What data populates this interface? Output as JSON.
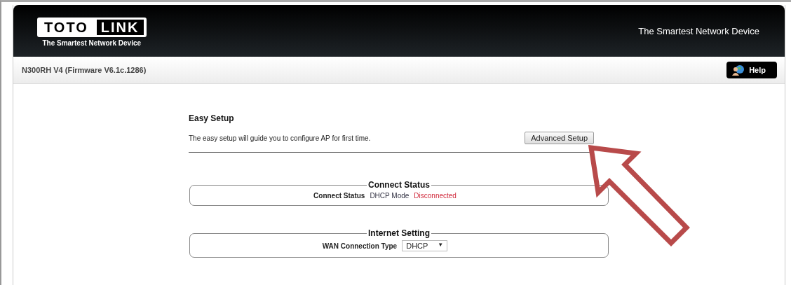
{
  "header": {
    "logo": {
      "part_1": "TOTO",
      "part_2": "LINK",
      "tagline": "The Smartest Network Device"
    },
    "slogan": "The Smartest Network Device"
  },
  "subbar": {
    "model": "N300RH V4 (Firmware V6.1c.1286)",
    "help_button": "Help"
  },
  "easy_setup": {
    "title": "Easy Setup",
    "description": "The easy setup will guide you to configure AP for first time.",
    "button": "Advanced Setup"
  },
  "connect_status": {
    "legend": "Connect Status",
    "label": "Connect Status",
    "mode": "DHCP Mode",
    "state": "Disconnected"
  },
  "internet_setting": {
    "legend": "Internet Setting",
    "label": "WAN Connection Type",
    "value": "DHCP",
    "caret": "▼"
  }
}
